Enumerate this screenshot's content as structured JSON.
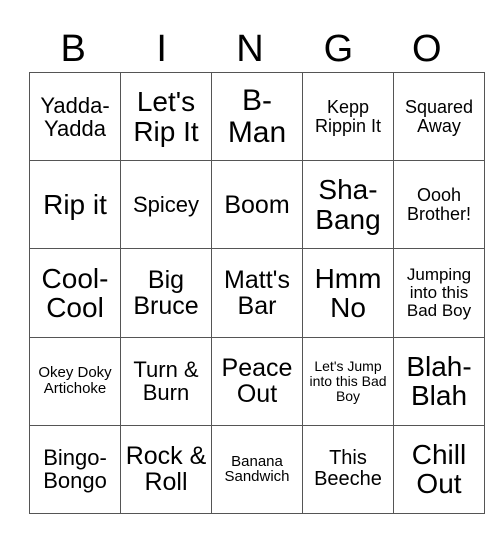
{
  "header": [
    "B",
    "I",
    "N",
    "G",
    "O"
  ],
  "rows": [
    [
      "Yadda-Yadda",
      "Let's Rip It",
      "B-Man",
      "Kepp Rippin It",
      "Squared Away"
    ],
    [
      "Rip it",
      "Spicey",
      "Boom",
      "Sha-Bang",
      "Oooh Brother!"
    ],
    [
      "Cool-Cool",
      "Big Bruce",
      "Matt's Bar",
      "Hmm No",
      "Jumping into this Bad Boy"
    ],
    [
      "Okey Doky Artichoke",
      "Turn & Burn",
      "Peace Out",
      "Let's Jump into this Bad Boy",
      "Blah-Blah"
    ],
    [
      "Bingo-Bongo",
      "Rock & Roll",
      "Banana Sandwich",
      "This Beeche",
      "Chill Out"
    ]
  ]
}
